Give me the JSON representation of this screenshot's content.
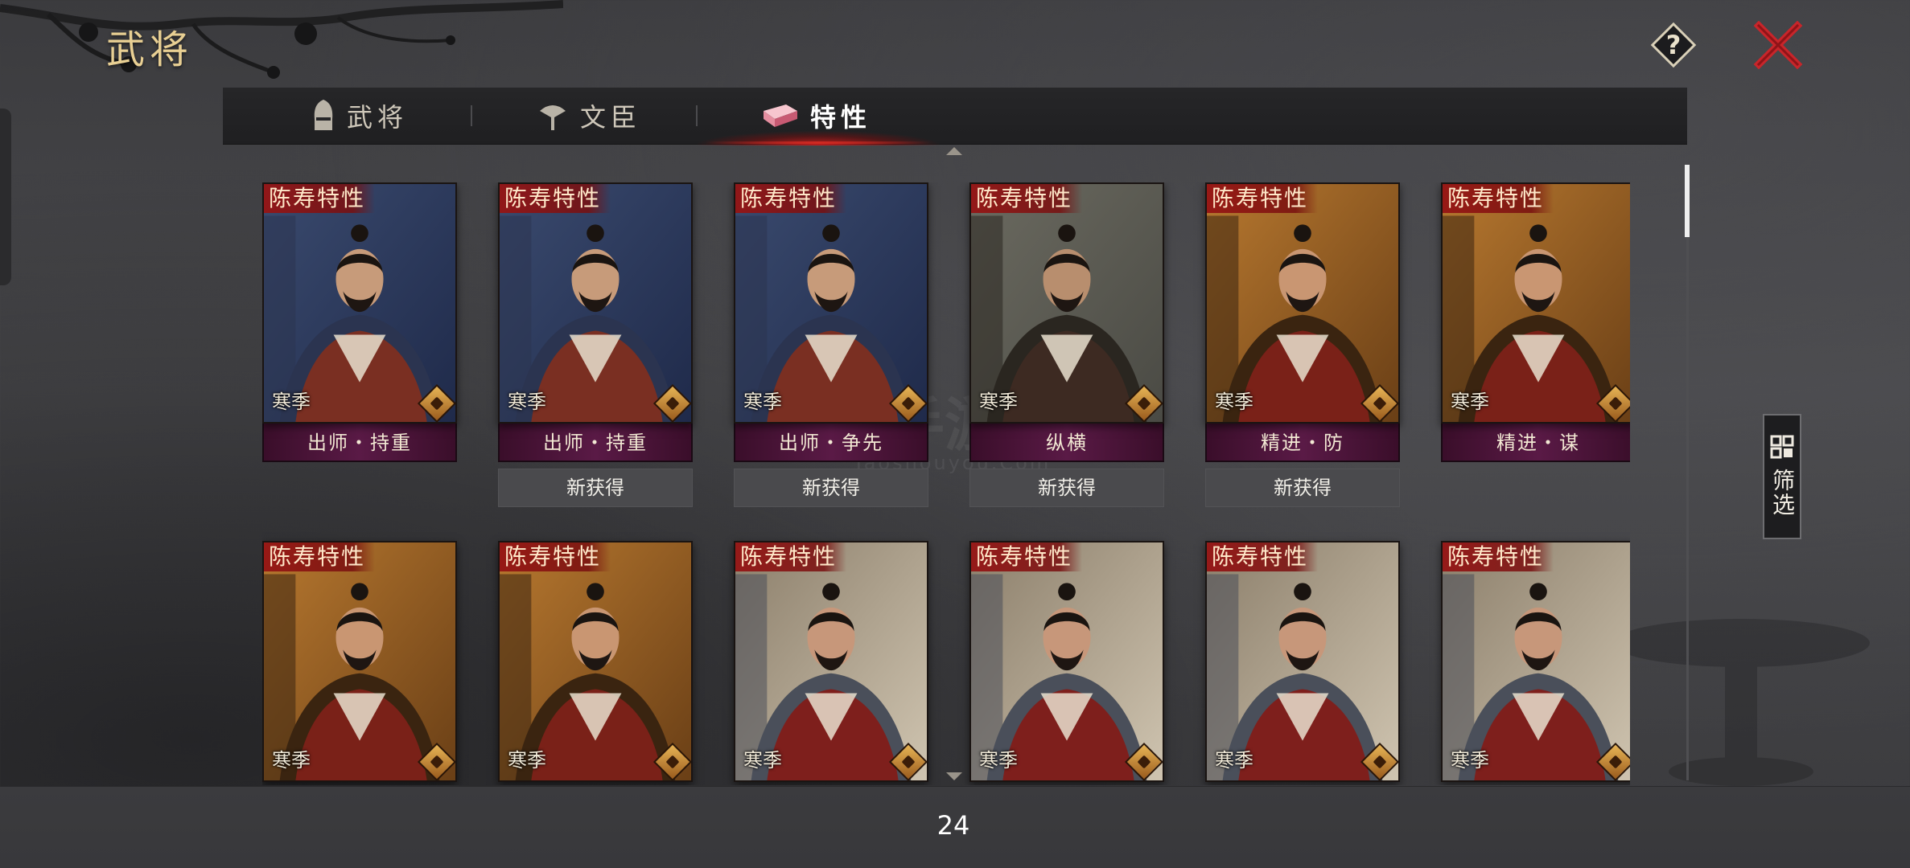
{
  "header": {
    "title": "武将"
  },
  "tabs": [
    {
      "label": "武将",
      "icon": "helmet-icon",
      "active": false
    },
    {
      "label": "文臣",
      "icon": "fan-icon",
      "active": false
    },
    {
      "label": "特性",
      "icon": "book-icon",
      "active": true
    }
  ],
  "filter": {
    "label": "筛选",
    "icon": "grid-icon"
  },
  "page_count": "24",
  "colors": {
    "accent": "#c8251f",
    "gold": "#e8cf93",
    "name_bar": "#4d1a3d"
  },
  "cards": [
    {
      "tag": "陈寿特性",
      "season": "寒季",
      "name": "出师・持重",
      "status": "",
      "art": "night"
    },
    {
      "tag": "陈寿特性",
      "season": "寒季",
      "name": "出师・持重",
      "status": "新获得",
      "art": "night"
    },
    {
      "tag": "陈寿特性",
      "season": "寒季",
      "name": "出师・争先",
      "status": "新获得",
      "art": "night"
    },
    {
      "tag": "陈寿特性",
      "season": "寒季",
      "name": "纵横",
      "status": "新获得",
      "art": "grey"
    },
    {
      "tag": "陈寿特性",
      "season": "寒季",
      "name": "精进・防",
      "status": "新获得",
      "art": "amber"
    },
    {
      "tag": "陈寿特性",
      "season": "寒季",
      "name": "精进・谋",
      "status": "",
      "art": "amber"
    },
    {
      "tag": "陈寿特性",
      "season": "寒季",
      "name": "",
      "status": "",
      "art": "amber"
    },
    {
      "tag": "陈寿特性",
      "season": "寒季",
      "name": "",
      "status": "",
      "art": "amber"
    },
    {
      "tag": "陈寿特性",
      "season": "寒季",
      "name": "",
      "status": "",
      "art": "field"
    },
    {
      "tag": "陈寿特性",
      "season": "寒季",
      "name": "",
      "status": "",
      "art": "field"
    },
    {
      "tag": "陈寿特性",
      "season": "寒季",
      "name": "",
      "status": "",
      "art": "field"
    },
    {
      "tag": "陈寿特性",
      "season": "寒季",
      "name": "",
      "status": "",
      "art": "field"
    }
  ]
}
